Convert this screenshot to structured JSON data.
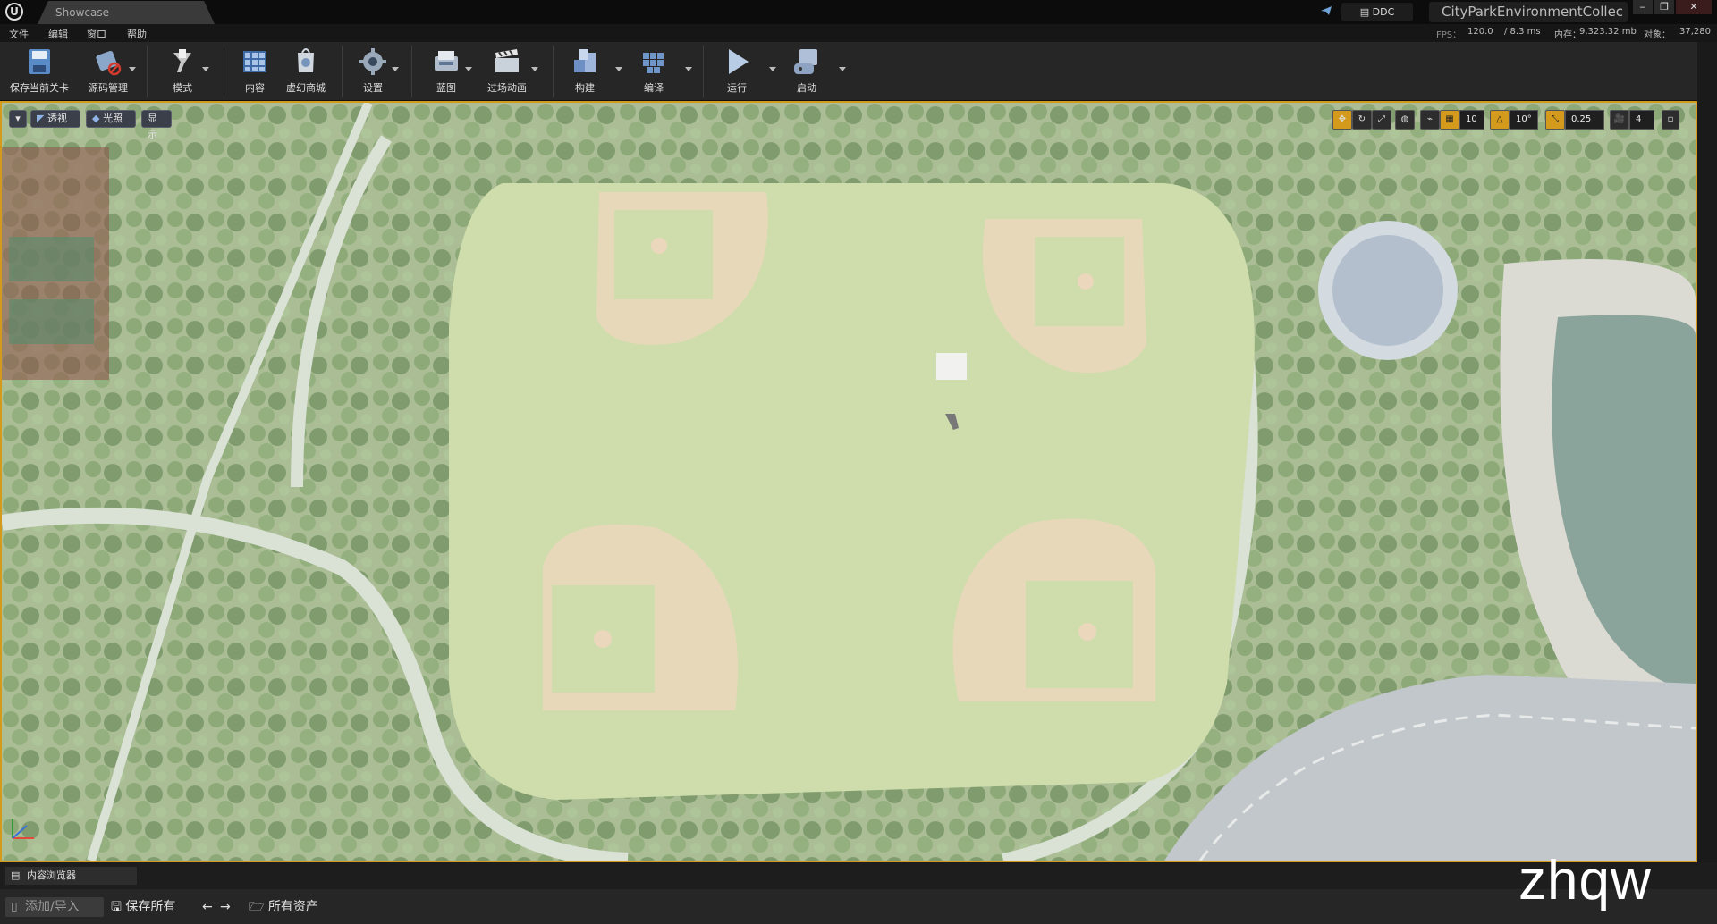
{
  "window": {
    "tab_title": "Showcase",
    "project_name": "CityParkEnvironmentCollec",
    "ddc_label": "DDC",
    "minimize": "‒",
    "restore": "❐",
    "close": "✕"
  },
  "menu": [
    "文件",
    "编辑",
    "窗口",
    "帮助"
  ],
  "stats": {
    "fps_label": "FPS：",
    "fps_value": "120.0",
    "ms_value": "/ 8.3 ms",
    "mem_label": "内存：",
    "mem_value": "9,323.32 mb",
    "obj_label": "对象：",
    "obj_value": "37,280"
  },
  "toolbar": [
    {
      "label": "保存当前关卡",
      "icon": "save-icon"
    },
    {
      "label": "源码管理",
      "icon": "source-control-icon"
    },
    {
      "label": "模式",
      "icon": "modes-icon"
    },
    {
      "label": "内容",
      "icon": "content-icon"
    },
    {
      "label": "虚幻商城",
      "icon": "marketplace-icon"
    },
    {
      "label": "设置",
      "icon": "settings-icon"
    },
    {
      "label": "蓝图",
      "icon": "blueprint-icon"
    },
    {
      "label": "过场动画",
      "icon": "cinematics-icon"
    },
    {
      "label": "构建",
      "icon": "build-icon"
    },
    {
      "label": "编译",
      "icon": "compile-icon"
    },
    {
      "label": "运行",
      "icon": "play-icon"
    },
    {
      "label": "启动",
      "icon": "launch-icon"
    }
  ],
  "viewport": {
    "perspective": "透视",
    "lit": "光照",
    "show": "显示",
    "grid_snap": "10",
    "rot_snap": "10°",
    "scale_snap": "0.25",
    "cam_speed": "4"
  },
  "content_browser": {
    "tab": "内容浏览器",
    "add_import": "添加/导入",
    "save_all": "保存所有",
    "path": "所有资产"
  },
  "watermark": "zhqw",
  "colors": {
    "accent": "#d39a1b",
    "field": "#c8d9a0",
    "infield": "#e8d2b3"
  }
}
